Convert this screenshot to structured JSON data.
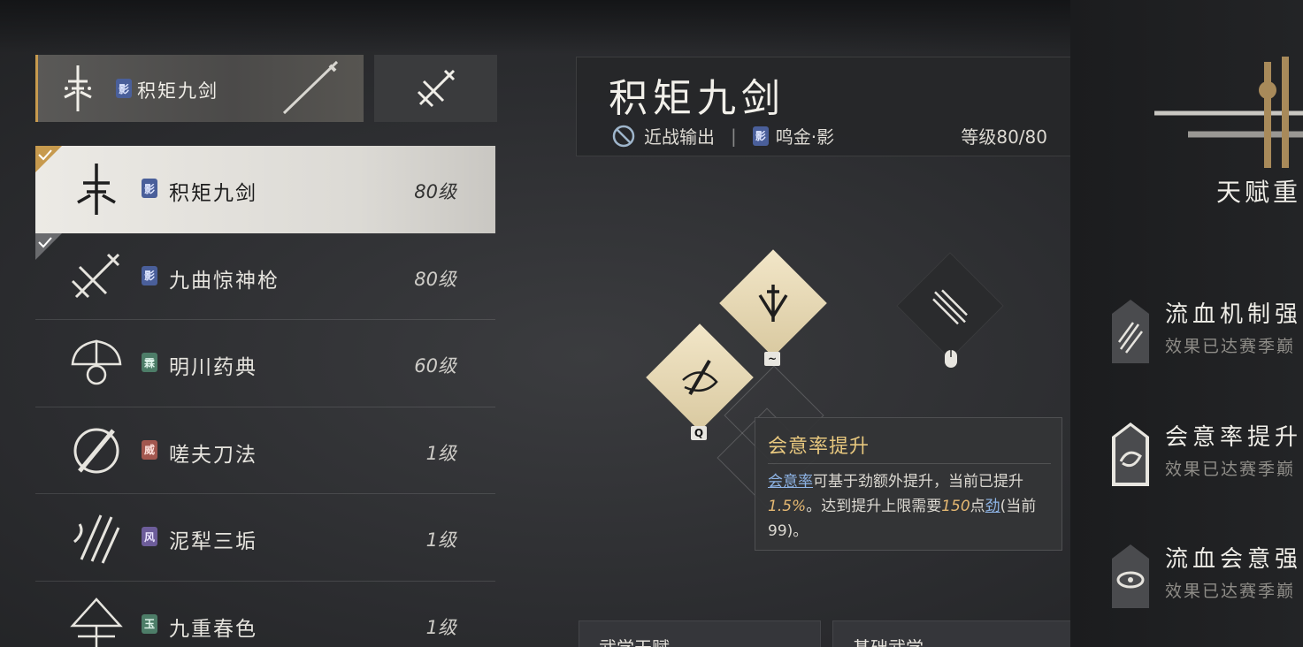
{
  "equipped": {
    "badge": "影",
    "name": "积矩九剑"
  },
  "weapons": [
    {
      "badge": "影",
      "name": "积矩九剑",
      "level": "80级",
      "selected": true,
      "owned": true,
      "badge_color": "#4a5f9a"
    },
    {
      "badge": "影",
      "name": "九曲惊神枪",
      "level": "80级",
      "selected": false,
      "owned": true,
      "badge_color": "#4a5f9a"
    },
    {
      "badge": "霖",
      "name": "明川药典",
      "level": "60级",
      "selected": false,
      "owned": false,
      "badge_color": "#4d7d68"
    },
    {
      "badge": "威",
      "name": "嗟夫刀法",
      "level": "1级",
      "selected": false,
      "owned": false,
      "badge_color": "#a2574f"
    },
    {
      "badge": "风",
      "name": "泥犁三垢",
      "level": "1级",
      "selected": false,
      "owned": false,
      "badge_color": "#6d5d9a"
    },
    {
      "badge": "玉",
      "name": "九重春色",
      "level": "1级",
      "selected": false,
      "owned": false,
      "badge_color": "#4d7d68"
    }
  ],
  "header": {
    "title": "积矩九剑",
    "role": "近战输出",
    "separator": "|",
    "school_badge": "影",
    "school": "鸣金·影",
    "level": "等级80/80"
  },
  "skills": {
    "key_q": "Q",
    "key_tilde": "~"
  },
  "tooltip": {
    "title": "会意率提升",
    "seg1_link": "会意率",
    "seg2": "可基于劲额外提升，当前已提升",
    "seg3_num": "1.5%",
    "seg4": "。达到提升上限需要",
    "seg5_num": "150",
    "seg6": "点",
    "seg7_link": "劲",
    "seg8": "(当前99)。"
  },
  "bottom_tabs": [
    "武学天赋",
    "基础武学"
  ],
  "right_panel": {
    "talent_title": "天赋重",
    "talents": [
      {
        "name": "流血机制强",
        "desc": "效果已达赛季巅"
      },
      {
        "name": "会意率提升",
        "desc": "效果已达赛季巅"
      },
      {
        "name": "流血会意强",
        "desc": "效果已达赛季巅"
      }
    ]
  },
  "colors": {
    "accent_gold": "#c79a4e",
    "tooltip_title": "#e7c77e",
    "link_blue": "#8eb4e6",
    "number_gold": "#e5b872"
  }
}
